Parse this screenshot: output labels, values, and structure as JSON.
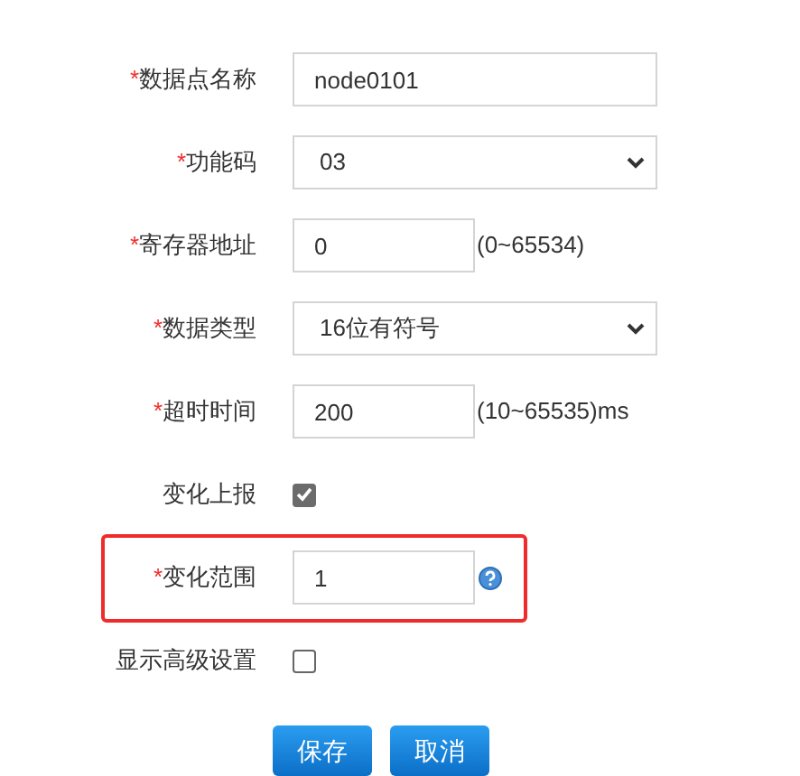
{
  "fields": [
    {
      "kind": "text",
      "label": "数据点名称",
      "mark": "*",
      "value": "node0101",
      "wide": true
    },
    {
      "kind": "select",
      "label": "功能码",
      "mark": "*",
      "value": "03"
    },
    {
      "kind": "text",
      "label": "寄存器地址",
      "mark": "*",
      "value": "0",
      "hint": "(0~65534)"
    },
    {
      "kind": "select",
      "label": "数据类型",
      "mark": "*",
      "value": "16位有符号"
    },
    {
      "kind": "text",
      "label": "超时时间",
      "mark": "*",
      "value": "200",
      "hint": "(10~65535)ms"
    },
    {
      "kind": "checkbox",
      "label": "变化上报",
      "checked": true
    },
    {
      "kind": "text",
      "label": "变化范围",
      "mark": "*",
      "value": "1",
      "help": true,
      "highlighted": true
    },
    {
      "kind": "checkbox",
      "label": "显示高级设置",
      "checked": false
    }
  ],
  "buttons": [
    "保存",
    "取消"
  ]
}
